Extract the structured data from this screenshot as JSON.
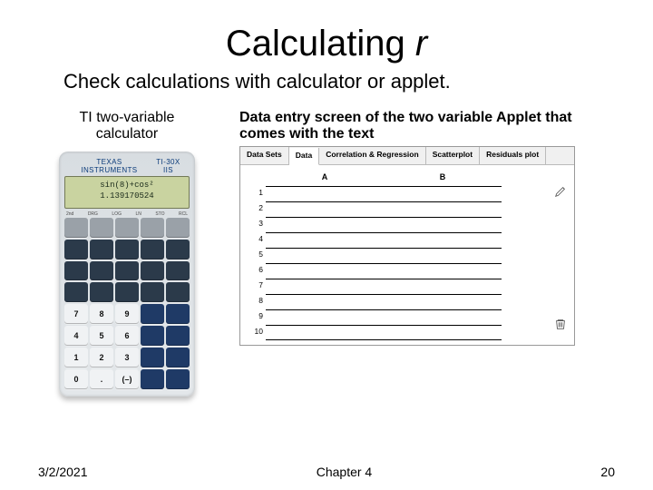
{
  "title_prefix": "Calculating ",
  "title_var": "r",
  "subtitle": "Check calculations with calculator or applet.",
  "left": {
    "caption_line1": "TI two-variable",
    "caption_line2": "calculator",
    "model_left": "TEXAS INSTRUMENTS",
    "model_right": "TI-30X IIS",
    "screen_line1": "sin(8)+cos²",
    "screen_line2": "1.139170524",
    "fn": [
      "2nd",
      "DRG",
      "LOG",
      "LN",
      "STO",
      "RCL"
    ]
  },
  "right": {
    "caption": "Data entry screen of the two variable Applet that comes with the text",
    "tabs": [
      "Data Sets",
      "Data",
      "Correlation & Regression",
      "Scatterplot",
      "Residuals plot"
    ],
    "active_tab": 1,
    "columns": [
      "A",
      "B"
    ],
    "rows": [
      "1",
      "2",
      "3",
      "4",
      "5",
      "6",
      "7",
      "8",
      "9",
      "10"
    ]
  },
  "footer": {
    "date": "3/2/2021",
    "chapter": "Chapter 4",
    "page": "20"
  }
}
